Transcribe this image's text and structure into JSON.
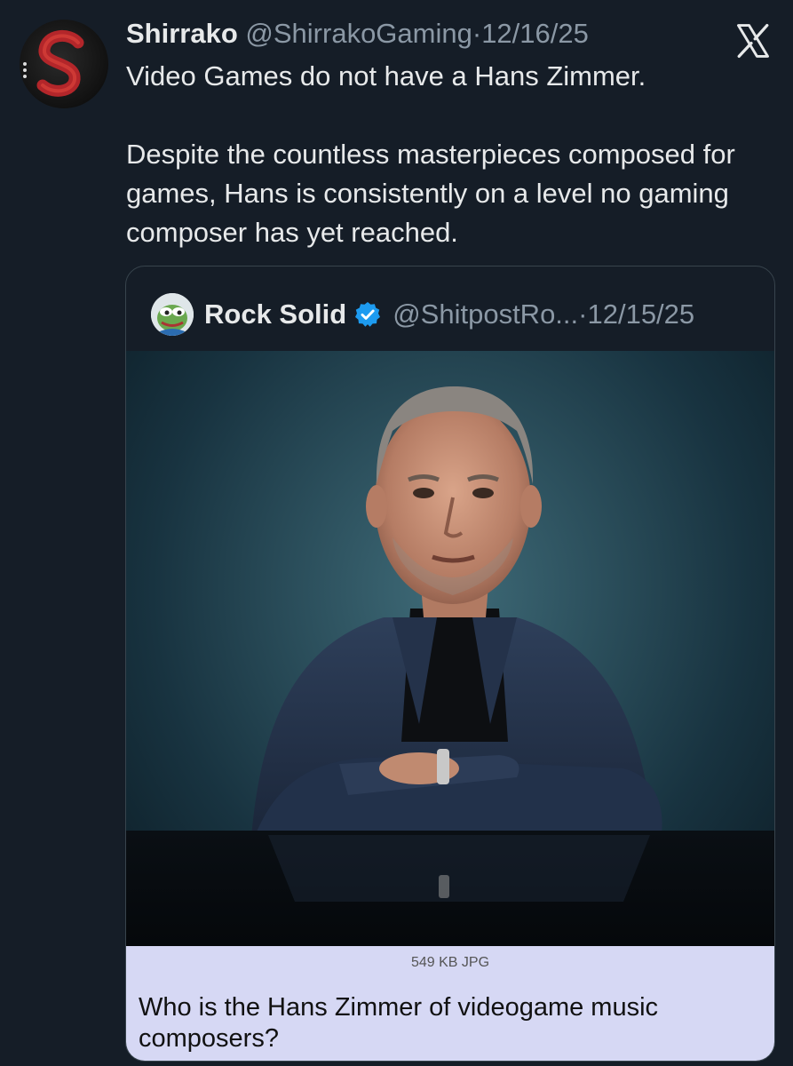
{
  "tweet": {
    "author_name": "Shirrako",
    "author_handle": "@ShirrakoGaming",
    "separator": "·",
    "date": "12/16/25",
    "text_line1": "Video Games do not have a Hans Zimmer.",
    "text_para2": "Despite the countless masterpieces composed for games, Hans is consistently on a level no gaming composer has yet reached."
  },
  "quoted": {
    "author_name": "Rock Solid",
    "author_handle": "@ShitpostRo...",
    "separator": "·",
    "date": "12/15/25",
    "image_description": "photo of Hans Zimmer",
    "file_info": "549 KB JPG",
    "caption": "Who is the Hans Zimmer of videogame music composers?"
  },
  "icons": {
    "x_logo": "x-logo-icon",
    "verified": "verified-badge-icon"
  },
  "colors": {
    "background": "#151d27",
    "text": "#e7e9ea",
    "muted": "#8b98a5",
    "verified": "#1d9bf0",
    "caption_bg": "#d6d8f4"
  }
}
